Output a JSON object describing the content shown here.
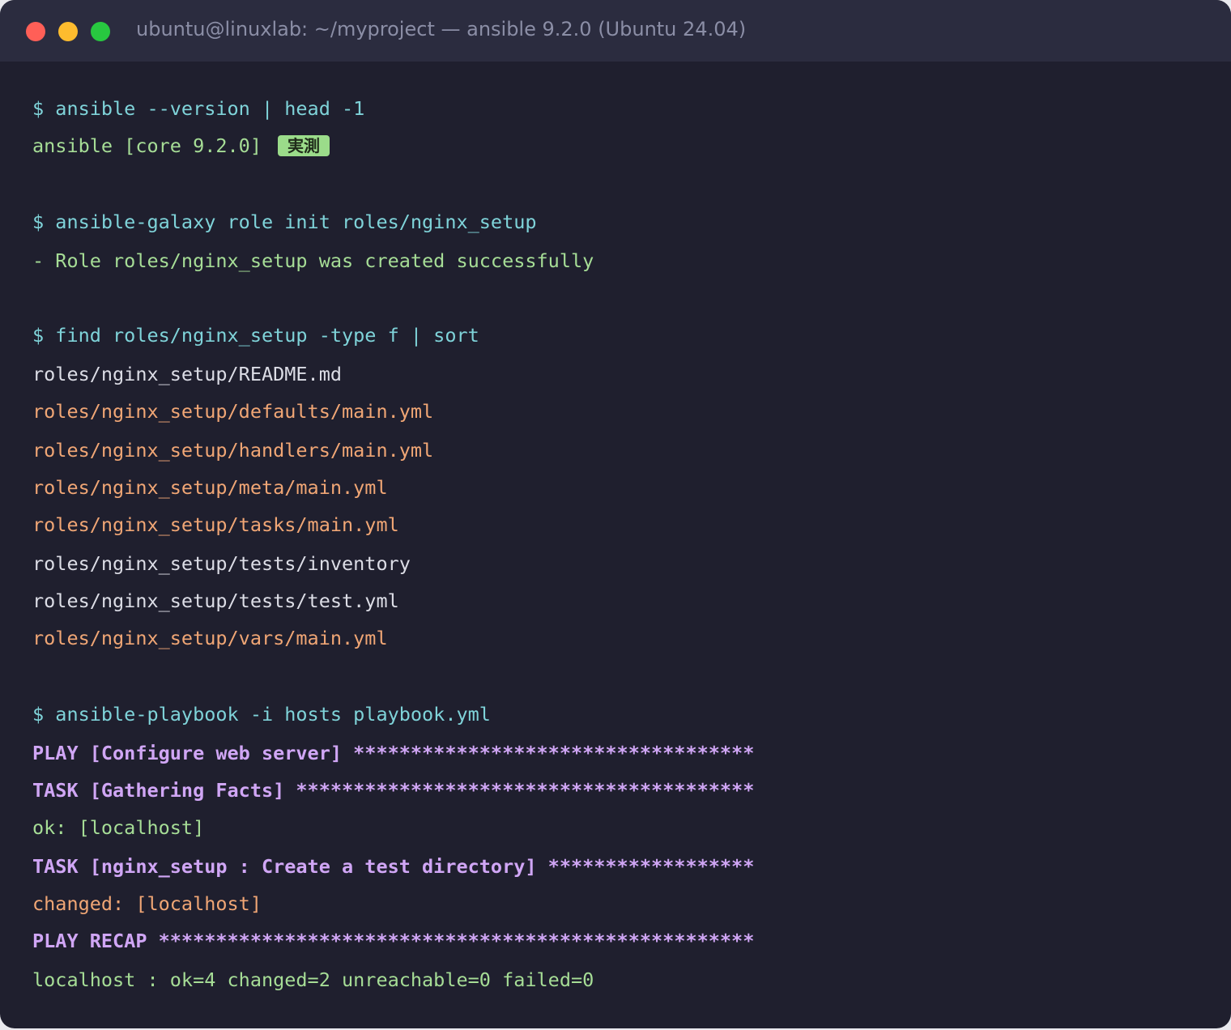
{
  "window": {
    "title": "ubuntu@linuxlab: ~/myproject — ansible 9.2.0 (Ubuntu 24.04)"
  },
  "terminal": {
    "lines": [
      {
        "text": "$ ansible --version | head -1",
        "kind": "command"
      },
      {
        "text": "ansible [core 9.2.0]",
        "kind": "output-green",
        "badge": "実測"
      },
      {
        "text": "$ ansible-galaxy role init roles/nginx_setup",
        "kind": "command"
      },
      {
        "text": "- Role roles/nginx_setup was created successfully",
        "kind": "output-green"
      },
      {
        "text": "$ find roles/nginx_setup -type f | sort",
        "kind": "command"
      },
      {
        "text": "roles/nginx_setup/README.md",
        "kind": "output-white"
      },
      {
        "text": "roles/nginx_setup/defaults/main.yml",
        "kind": "output-orange"
      },
      {
        "text": "roles/nginx_setup/handlers/main.yml",
        "kind": "output-orange"
      },
      {
        "text": "roles/nginx_setup/meta/main.yml",
        "kind": "output-orange"
      },
      {
        "text": "roles/nginx_setup/tasks/main.yml",
        "kind": "output-orange"
      },
      {
        "text": "roles/nginx_setup/tests/inventory",
        "kind": "output-white"
      },
      {
        "text": "roles/nginx_setup/tests/test.yml",
        "kind": "output-white"
      },
      {
        "text": "roles/nginx_setup/vars/main.yml",
        "kind": "output-orange"
      },
      {
        "text": "$ ansible-playbook -i hosts playbook.yml",
        "kind": "command"
      },
      {
        "text": "PLAY [Configure web server] ***********************************",
        "kind": "output-purple"
      },
      {
        "text": "TASK [Gathering Facts] ****************************************",
        "kind": "output-purple"
      },
      {
        "text": "ok: [localhost]",
        "kind": "output-green"
      },
      {
        "text": "TASK [nginx_setup : Create a test directory] ******************",
        "kind": "output-purple"
      },
      {
        "text": "changed: [localhost]",
        "kind": "output-orange"
      },
      {
        "text": "PLAY RECAP ****************************************************",
        "kind": "output-purple"
      },
      {
        "text": "localhost : ok=4 changed=2 unreachable=0 failed=0",
        "kind": "output-green"
      }
    ]
  },
  "colors": {
    "background": "#1f1f2e",
    "titlebar": "#2b2c3f",
    "command": "#7fd3d9",
    "output_green": "#a6dd96",
    "output_white": "#dcdde6",
    "output_orange": "#f0a675",
    "output_purple": "#d0a6f5",
    "badge": "#9bdc8a"
  }
}
